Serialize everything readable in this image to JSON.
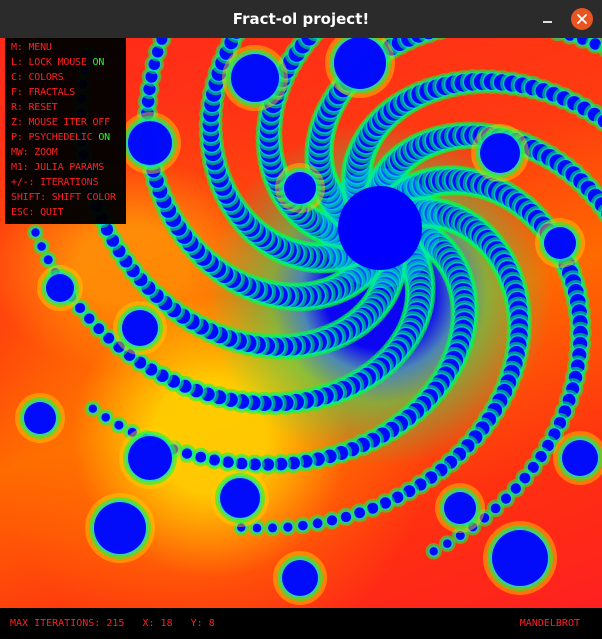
{
  "window": {
    "title": "Fract-ol project!",
    "close_icon": "close-icon",
    "minimize_icon": "minimize-icon",
    "close_color": "#e95420"
  },
  "menu": {
    "items": [
      {
        "text": "M: MENU"
      },
      {
        "text": "L: LOCK MOUSE ",
        "state": "ON"
      },
      {
        "text": "C: COLORS"
      },
      {
        "text": "F: FRACTALS"
      },
      {
        "text": "R: RESET"
      },
      {
        "text": "Z: MOUSE ITER OFF"
      },
      {
        "text": "P: PSYCHEDELIC ",
        "state": "ON"
      },
      {
        "text": "MW: ZOOM"
      },
      {
        "text": "M1: JULIA PARAMS"
      },
      {
        "text": "+/-: ITERATIONS"
      },
      {
        "text": "SHIFT: SHIFT COLOR"
      },
      {
        "text": "ESC: QUIT"
      }
    ],
    "text_color": "#ff2020",
    "on_color": "#22ff22"
  },
  "status": {
    "iterations_label": "MAX ITERATIONS:",
    "iterations_value": "215",
    "x_label": "X:",
    "x_value": "18",
    "y_label": "Y:",
    "y_value": "8",
    "fractal_name": "MANDELBROT"
  },
  "palette": {
    "outer": "#ff2020",
    "mid": "#ffd000",
    "inner": "#00ff40",
    "cyan": "#00d8ff",
    "core": "#0000ff"
  }
}
